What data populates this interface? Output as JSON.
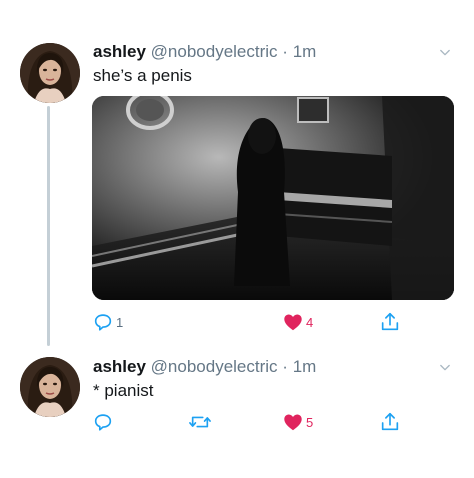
{
  "tweets": [
    {
      "name": "ashley",
      "handle": "@nobodyelectric",
      "separator": "·",
      "time": "1m",
      "text": "she’s a penis",
      "has_media": true,
      "actions": {
        "reply_count": "1",
        "retweet_count": "",
        "like_count": "4"
      }
    },
    {
      "name": "ashley",
      "handle": "@nobodyelectric",
      "separator": "·",
      "time": "1m",
      "text": "* pianist",
      "has_media": false,
      "actions": {
        "reply_count": "",
        "retweet_count": "",
        "like_count": "5"
      }
    }
  ],
  "icons": {
    "reply": "reply-icon",
    "retweet": "retweet-icon",
    "like": "heart-icon",
    "share": "share-icon",
    "menu": "chevron-down-icon"
  },
  "colors": {
    "like_red": "#e0245e",
    "icon_blue": "#1da1f2",
    "muted": "#657786",
    "thread_line": "#c4cfd6"
  }
}
